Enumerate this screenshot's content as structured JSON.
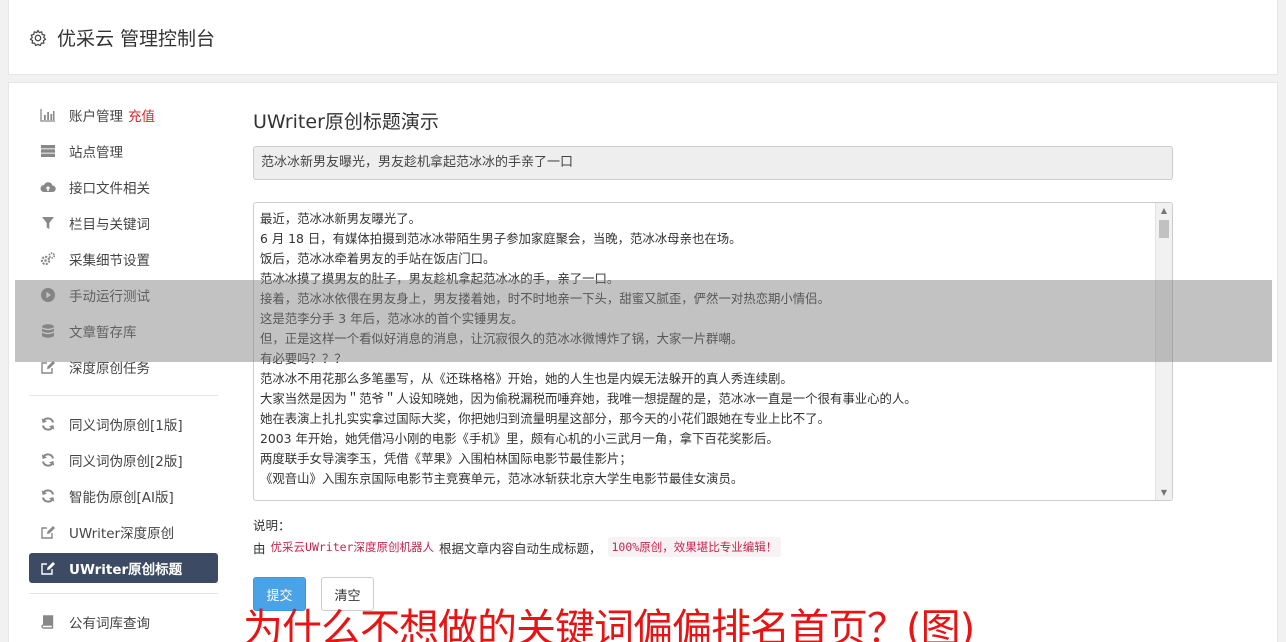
{
  "header": {
    "icon": "gear-icon",
    "title": "优采云 管理控制台"
  },
  "sidebar": {
    "items": [
      {
        "icon": "bar-chart-icon",
        "label": "账户管理",
        "badge": "充值"
      },
      {
        "icon": "server-icon",
        "label": "站点管理"
      },
      {
        "icon": "cloud-upload-icon",
        "label": "接口文件相关"
      },
      {
        "icon": "filter-icon",
        "label": "栏目与关键词"
      },
      {
        "icon": "gears-icon",
        "label": "采集细节设置"
      },
      {
        "icon": "play-circle-icon",
        "label": "手动运行测试"
      },
      {
        "icon": "database-icon",
        "label": "文章暂存库"
      },
      {
        "icon": "edit-icon",
        "label": "深度原创任务"
      }
    ],
    "items2": [
      {
        "icon": "refresh-icon",
        "label": "同义词伪原创[1版]"
      },
      {
        "icon": "refresh-icon",
        "label": "同义词伪原创[2版]"
      },
      {
        "icon": "refresh-icon",
        "label": "智能伪原创[AI版]"
      },
      {
        "icon": "edit-icon",
        "label": "UWriter深度原创"
      },
      {
        "icon": "edit-icon",
        "label": "UWriter原创标题",
        "active": true
      }
    ],
    "items3": [
      {
        "icon": "book-icon",
        "label": "公有词库查询"
      }
    ]
  },
  "main": {
    "heading": "UWriter原创标题演示",
    "title_value": "范冰冰新男友曝光，男友趁机拿起范冰冰的手亲了一口",
    "article_lines": [
      "最近，范冰冰新男友曝光了。",
      "6 月 18 日，有媒体拍摄到范冰冰带陌生男子参加家庭聚会，当晚，范冰冰母亲也在场。",
      "饭后，范冰冰牵着男友的手站在饭店门口。",
      "范冰冰摸了摸男友的肚子，男友趁机拿起范冰冰的手，亲了一口。",
      "接着，范冰冰依偎在男友身上，男友搂着她，时不时地亲一下头，甜蜜又腻歪，俨然一对热恋期小情侣。",
      "这是范李分手 3 年后，范冰冰的首个实锤男友。",
      "但，正是这样一个看似好消息的消息，让沉寂很久的范冰冰微博炸了锅，大家一片群嘲。",
      "有必要吗？？？",
      "范冰冰不用花那么多笔墨写，从《还珠格格》开始，她的人生也是内娱无法躲开的真人秀连续剧。",
      "大家当然是因为＂范爷＂人设知晓她，因为偷税漏税而唾弃她，我唯一想提醒的是，范冰冰一直是一个很有事业心的人。",
      "她在表演上扎扎实实拿过国际大奖，你把她归到流量明星这部分，那今天的小花们跟她在专业上比不了。",
      "2003 年开始，她凭借冯小刚的电影《手机》里，颇有心机的小三武月一角，拿下百花奖影后。",
      "两度联手女导演李玉，凭借《苹果》入围柏林国际电影节最佳影片；",
      "《观音山》入围东京国际电影节主竞赛单元，范冰冰斩获北京大学生电影节最佳女演员。"
    ],
    "note_label": "说明：",
    "note_prefix": "由",
    "note_code1": "优采云UWriter深度原创机器人",
    "note_middle": "根据文章内容自动生成标题，",
    "note_code2": "100%原创，效果堪比专业编辑！",
    "submit_label": "提交",
    "clear_label": "清空"
  },
  "watermark": "为什么不想做的关键词偏偏排名首页？(图)",
  "colors": {
    "active_nav_bg": "#3c4b63",
    "submit_bg": "#4aa3e6",
    "badge": "#d9282a",
    "code": "#c7254e",
    "watermark": "#e81414"
  }
}
